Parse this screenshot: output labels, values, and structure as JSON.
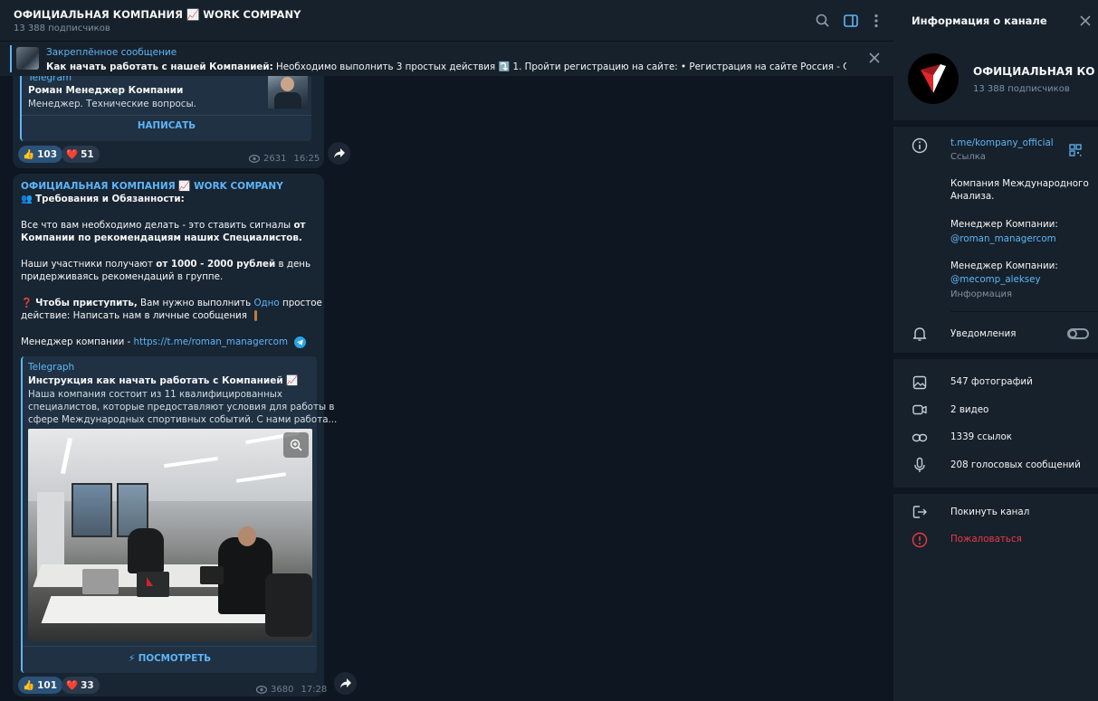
{
  "header": {
    "title": "ОФИЦИАЛЬНАЯ КОМПАНИЯ 📈 WORK COMPANY",
    "subscribers": "13 388 подписчиков"
  },
  "pinned": {
    "label": "Закреплённое сообщение",
    "text_bold": "Как начать работать с нашей Компанией:",
    "text_rest": " Необходимо выполнить 3 простых действия ⤵️ 1. Пройти регистрацию на сайте:  • Регистрация на сайте Россия - ССЫЛКА ДЛЯ Р..."
  },
  "msg1": {
    "card_site": "Telegram",
    "card_title": "Роман Менеджер Компании",
    "card_desc": "Менеджер. Технические вопросы.",
    "card_button": "НАПИСАТЬ",
    "reaction1_emoji": "👍",
    "reaction1_count": "103",
    "reaction2_emoji": "❤️",
    "reaction2_count": "51",
    "views": "2631",
    "time": "16:25"
  },
  "msg2": {
    "author": "ОФИЦИАЛЬНАЯ КОМПАНИЯ 📈 WORK COMPANY",
    "line1_emoji": "👥",
    "line1_bold": "Требования и Обязанности:",
    "p1_a": "Все что вам необходимо делать - это ставить сигналы ",
    "p1_b": "от",
    "p1_c": "Компании по рекомендациям наших Специалистов.",
    "p2_a": "Наши участники получают ",
    "p2_b": "от 1000 - 2000 рублей",
    "p2_c": " в день",
    "p2_d": "придерживаясь рекомендаций в группе.",
    "p3_emoji": "❓",
    "p3_bold": "Чтобы приступить,",
    "p3_a": " Вам нужно выполнить ",
    "p3_link": "Одно",
    "p3_b": " простое",
    "p3_c": "действие: Написать нам в личные сообщения",
    "p4_a": "Менеджер компании - ",
    "p4_link": "https://t.me/roman_managercom",
    "card_site": "Telegraph",
    "card_title": "Инструкция как начать работать с Компанией 📈",
    "card_desc1": "Наша компания состоит из 11 квалифицированных",
    "card_desc2": "специалистов, которые предоставляют условия для работы в",
    "card_desc3": "сфере Международных спортивных событий. С нами работа...",
    "card_button": "ПОСМОТРЕТЬ",
    "reaction1_emoji": "👍",
    "reaction1_count": "101",
    "reaction2_emoji": "❤️",
    "reaction2_count": "33",
    "views": "3680",
    "time": "17:28"
  },
  "panel": {
    "title": "Информация о канале",
    "name": "ОФИЦИАЛЬНАЯ КОМПАНИЯ",
    "subscribers": "13 388 подписчиков",
    "link": "t.me/kompany_official",
    "link_label": "Ссылка",
    "desc1": "Компания Международного",
    "desc2": "Анализа.",
    "desc3": "Менеджер Компании:",
    "desc4": "@roman_managercom",
    "desc5": "Менеджер Компании:",
    "desc6": "@mecomp_aleksey",
    "desc_label": "Информация",
    "notifications": "Уведомления",
    "photos": "547 фотографий",
    "videos": "2 видео",
    "links": "1339 ссылок",
    "voice": "208 голосовых сообщений",
    "leave": "Покинуть канал",
    "report": "Пожаловаться"
  },
  "colors": {
    "accent": "#5eb5f7",
    "danger": "#ec3942",
    "bubble": "#182533",
    "panel": "#17212b"
  }
}
